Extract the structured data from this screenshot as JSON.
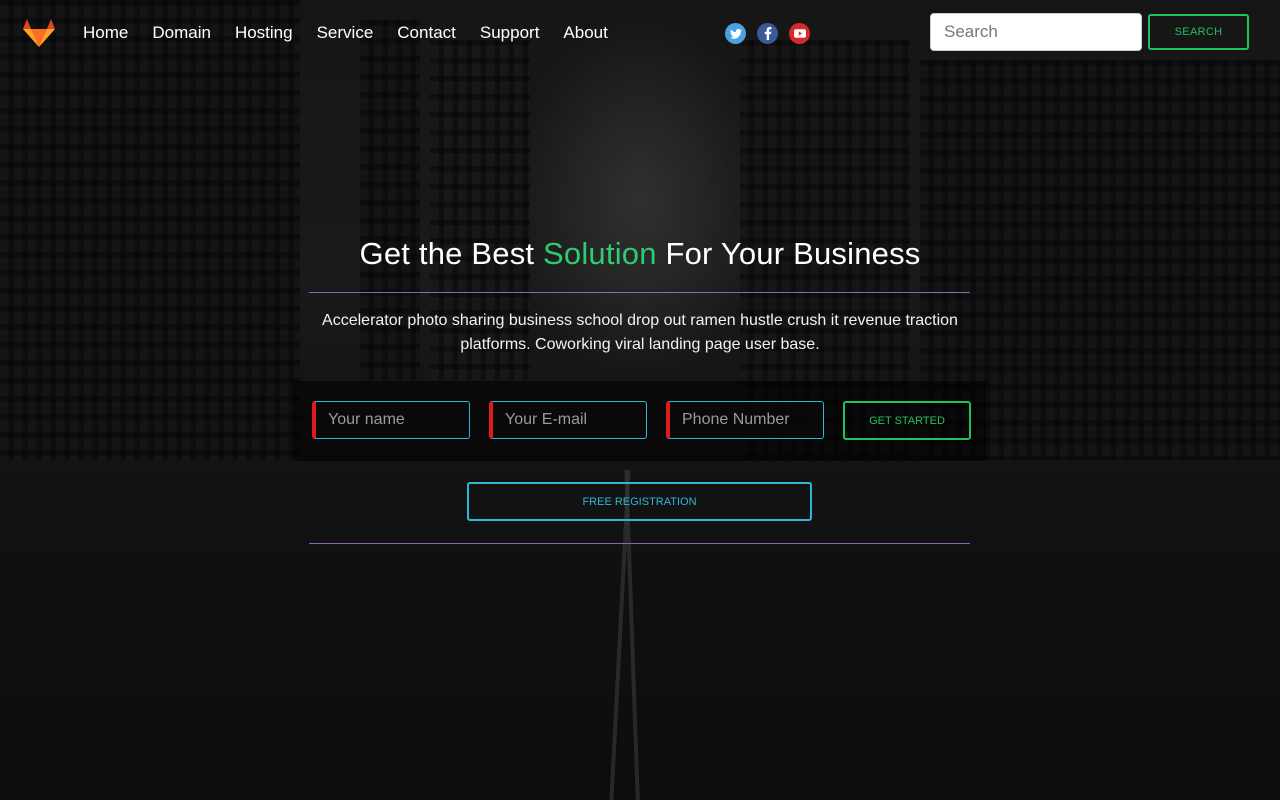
{
  "nav": {
    "items": [
      {
        "label": "Home"
      },
      {
        "label": "Domain"
      },
      {
        "label": "Hosting"
      },
      {
        "label": "Service"
      },
      {
        "label": "Contact"
      },
      {
        "label": "Support"
      },
      {
        "label": "About"
      }
    ]
  },
  "social": {
    "items": [
      {
        "icon": "twitter-icon",
        "glyph": "t",
        "color": "#4aa3df"
      },
      {
        "icon": "facebook-icon",
        "glyph": "f",
        "color": "#3b5998"
      },
      {
        "icon": "youtube-icon",
        "glyph": "▶",
        "color": "#d62a2a"
      }
    ]
  },
  "search": {
    "placeholder": "Search",
    "button_label": "SEARCH"
  },
  "hero": {
    "title_pre": "Get the Best ",
    "title_accent": "Solution",
    "title_post": " For Your Business",
    "description": "Accelerator photo sharing business school drop out ramen hustle crush it revenue traction platforms. Coworking viral landing page user base."
  },
  "form": {
    "name_placeholder": "Your name",
    "email_placeholder": "Your E-mail",
    "phone_placeholder": "Phone Number",
    "submit_label": "GET STARTED",
    "register_label": "FREE REGISTRATION"
  },
  "colors": {
    "accent_green": "#21c25e",
    "accent_cyan": "#2fb7d9",
    "accent_red": "#e01b1b",
    "rule_purple": "#8e63b8",
    "logo_orange": "#fc6d26"
  }
}
